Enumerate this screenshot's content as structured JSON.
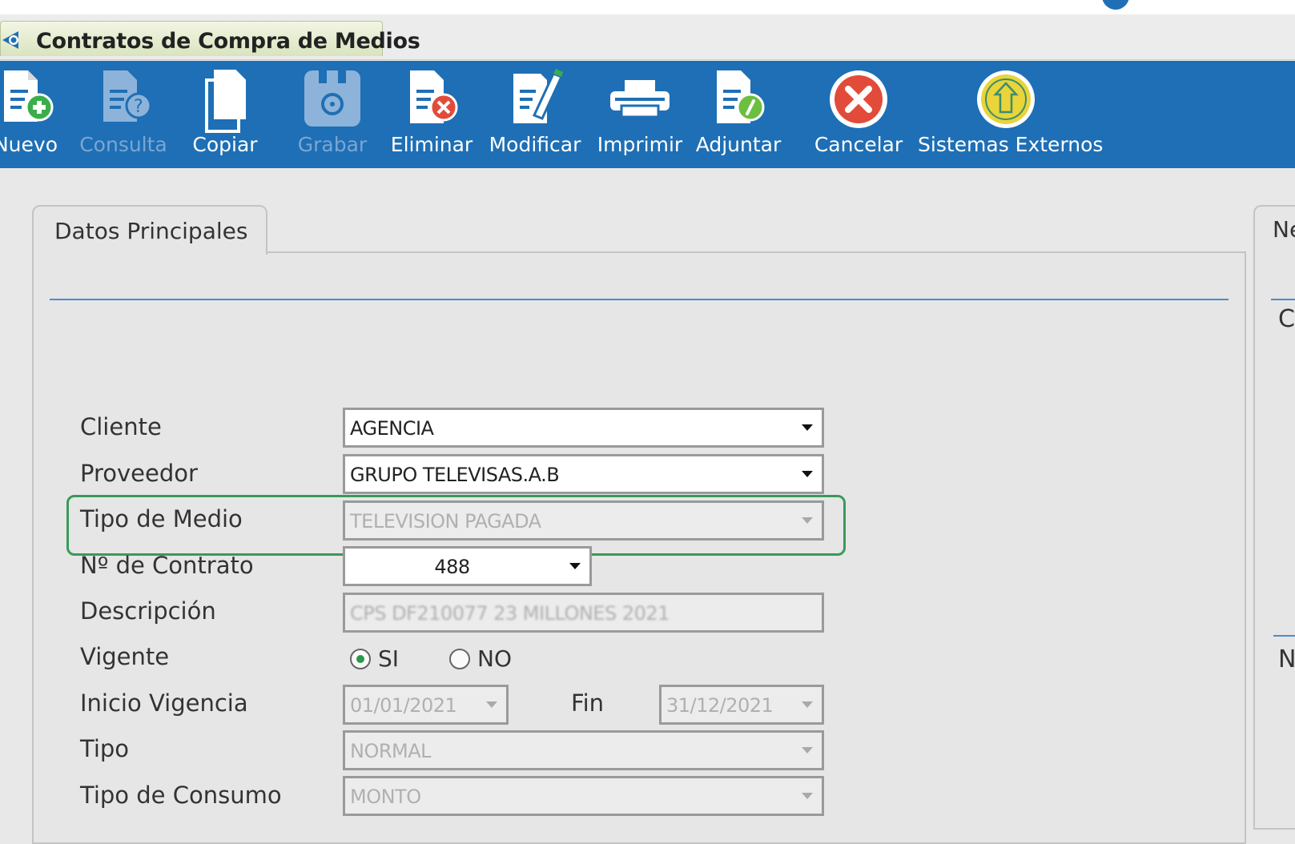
{
  "window": {
    "tab_title": "Contratos de Compra de Medios"
  },
  "toolbar": {
    "items": [
      {
        "label": "Nuevo",
        "enabled": true,
        "icon": "new-document-icon"
      },
      {
        "label": "Consulta",
        "enabled": false,
        "icon": "query-document-icon"
      },
      {
        "label": "Copiar",
        "enabled": true,
        "icon": "copy-icon"
      },
      {
        "label": "Grabar",
        "enabled": false,
        "icon": "save-disk-icon"
      },
      {
        "label": "Eliminar",
        "enabled": true,
        "icon": "delete-document-icon"
      },
      {
        "label": "Modificar",
        "enabled": true,
        "icon": "edit-document-icon"
      },
      {
        "label": "Imprimir",
        "enabled": true,
        "icon": "printer-icon"
      },
      {
        "label": "Adjuntar",
        "enabled": true,
        "icon": "attach-document-icon"
      },
      {
        "label": "Cancelar",
        "enabled": true,
        "icon": "cancel-icon"
      },
      {
        "label": "Sistemas Externos",
        "enabled": true,
        "icon": "external-systems-icon"
      }
    ]
  },
  "main_tab": {
    "label": "Datos Principales"
  },
  "right_panel": {
    "tab_label_partial": "Ne",
    "section1_partial": "C",
    "section2_partial": "N"
  },
  "form": {
    "cliente": {
      "label": "Cliente",
      "value": "AGENCIA"
    },
    "proveedor": {
      "label": "Proveedor",
      "value": "GRUPO TELEVISAS.A.B"
    },
    "tipo_medio": {
      "label": "Tipo de Medio",
      "value": "TELEVISION PAGADA"
    },
    "num_contrato": {
      "label": "Nº de Contrato",
      "value": "488"
    },
    "descripcion": {
      "label": "Descripción",
      "value": "CPS DF210077 23 MILLONES 2021"
    },
    "vigente": {
      "label": "Vigente",
      "option_si": "SI",
      "option_no": "NO",
      "selected": "SI"
    },
    "inicio_vigencia": {
      "label": "Inicio Vigencia",
      "value": "01/01/2021"
    },
    "fin": {
      "label": "Fin",
      "value": "31/12/2021"
    },
    "tipo": {
      "label": "Tipo",
      "value": "NORMAL"
    },
    "tipo_consumo": {
      "label": "Tipo de Consumo",
      "value": "MONTO"
    }
  },
  "colors": {
    "toolbar_bg": "#1e6fb5",
    "highlight_border": "#3a9a5a",
    "accent_rule": "#4d8ccc"
  }
}
